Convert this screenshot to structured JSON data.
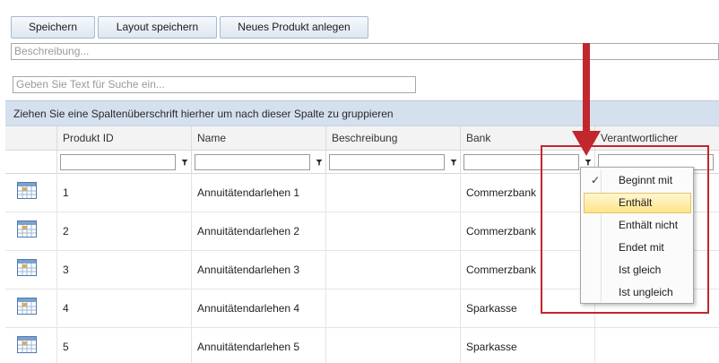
{
  "toolbar": {
    "save_label": "Speichern",
    "layout_label": "Layout speichern",
    "new_product_label": "Neues Produkt anlegen"
  },
  "description_field": {
    "placeholder": "Beschreibung..."
  },
  "search_field": {
    "placeholder": "Geben Sie Text für Suche ein..."
  },
  "group_panel": {
    "text": "Ziehen Sie eine Spaltenüberschrift hierher um nach dieser Spalte zu gruppieren"
  },
  "grid": {
    "columns": [
      "Produkt ID",
      "Name",
      "Beschreibung",
      "Bank",
      "Verantwortlicher"
    ],
    "rows": [
      {
        "id": "1",
        "name": "Annuitätendarlehen 1",
        "description": "",
        "bank": "Commerzbank",
        "responsible": ""
      },
      {
        "id": "2",
        "name": "Annuitätendarlehen 2",
        "description": "",
        "bank": "Commerzbank",
        "responsible": ""
      },
      {
        "id": "3",
        "name": "Annuitätendarlehen 3",
        "description": "",
        "bank": "Commerzbank",
        "responsible": ""
      },
      {
        "id": "4",
        "name": "Annuitätendarlehen 4",
        "description": "",
        "bank": "Sparkasse",
        "responsible": ""
      },
      {
        "id": "5",
        "name": "Annuitätendarlehen 5",
        "description": "",
        "bank": "Sparkasse",
        "responsible": ""
      }
    ]
  },
  "filter_menu": {
    "check_mark": "✓",
    "items": [
      "Beginnt mit",
      "Enthält",
      "Enthält nicht",
      "Endet mit",
      "Ist gleich",
      "Ist ungleich"
    ],
    "checked_index": 0,
    "highlighted_index": 1
  },
  "colors": {
    "annotation_red": "#c1272d",
    "group_panel_bg": "#d4e0ee",
    "menu_highlight": "#ffe48a"
  }
}
